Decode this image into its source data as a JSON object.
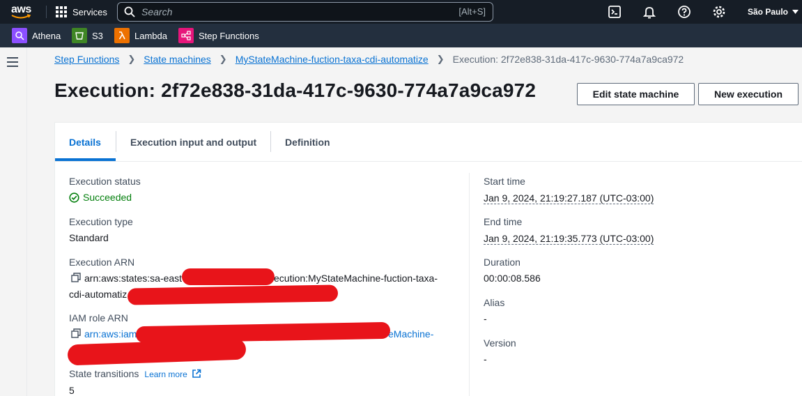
{
  "nav": {
    "logo_text": "aws",
    "services_label": "Services",
    "search_placeholder": "Search",
    "search_shortcut": "[Alt+S]",
    "region": "São Paulo"
  },
  "favorites": [
    {
      "label": "Athena",
      "color": "#8c4fff"
    },
    {
      "label": "S3",
      "color": "#3f8624"
    },
    {
      "label": "Lambda",
      "color": "#ed7100"
    },
    {
      "label": "Step Functions",
      "color": "#e7157b"
    }
  ],
  "breadcrumb": {
    "items": [
      "Step Functions",
      "State machines",
      "MyStateMachine-fuction-taxa-cdi-automatize"
    ],
    "current": "Execution: 2f72e838-31da-417c-9630-774a7a9ca972"
  },
  "page": {
    "title": "Execution: 2f72e838-31da-417c-9630-774a7a9ca972",
    "edit_button": "Edit state machine",
    "new_button": "New execution"
  },
  "tabs": [
    "Details",
    "Execution input and output",
    "Definition"
  ],
  "details": {
    "status_label": "Execution status",
    "status_value": "Succeeded",
    "type_label": "Execution type",
    "type_value": "Standard",
    "arn_label": "Execution ARN",
    "arn_line1_a": "arn:aws:states:sa-east",
    "arn_line1_b": "ecution:MyStateMachine-fuction-taxa-",
    "arn_line2": "cdi-automatiz",
    "role_label": "IAM role ARN",
    "role_line1_a": "arn:aws:iam",
    "role_line1_b": "eMachine-",
    "transitions_label": "State transitions",
    "learn_more": "Learn more",
    "transitions_value": "5",
    "start_label": "Start time",
    "start_value": "Jan 9, 2024, 21:19:27.187 (UTC-03:00)",
    "end_label": "End time",
    "end_value": "Jan 9, 2024, 21:19:35.773 (UTC-03:00)",
    "duration_label": "Duration",
    "duration_value": "00:00:08.586",
    "alias_label": "Alias",
    "alias_value": "-",
    "version_label": "Version",
    "version_value": "-"
  }
}
